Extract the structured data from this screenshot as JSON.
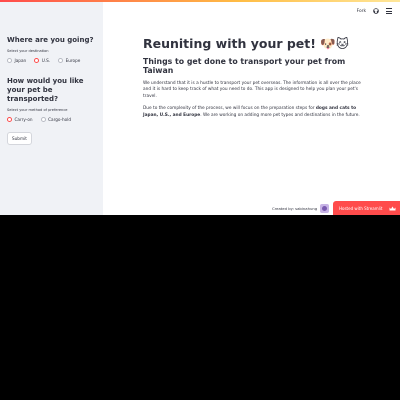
{
  "header": {
    "fork_label": "Fork"
  },
  "sidebar": {
    "destination": {
      "heading": "Where are you going?",
      "label": "Select your destination",
      "options": [
        "Japan",
        "U.S.",
        "Europe"
      ],
      "selected": "U.S."
    },
    "transport": {
      "heading": "How would you like your pet be transported?",
      "label": "Select your method of preference",
      "options": [
        "Carry-on",
        "Cargo-hold"
      ],
      "selected": "Carry-on"
    },
    "submit_label": "Submit"
  },
  "main": {
    "title": "Reuniting with your pet! 🐶🐱",
    "subtitle": "Things to get done to transport your pet from Taiwan",
    "para1": "We understand that it is a hustle to transport your pet overseas. The information is all over the place and it is hard to keep track of what you need to do. This app is designed to help you plan your pet's travel.",
    "para2_prefix": "Due to the complexity of the process, we will focus on the preparation steps for ",
    "para2_bold": "dogs and cats to Japan, U.S., and Europe",
    "para2_suffix": ". We are working on adding more pet types and destinations in the future."
  },
  "footer": {
    "created_by": "Created by: sabinahung",
    "hosted_label": "Hosted with Streamlit"
  },
  "colors": {
    "accent": "#ff4b4b",
    "sidebar_bg": "#f0f2f6",
    "text": "#31333f"
  }
}
